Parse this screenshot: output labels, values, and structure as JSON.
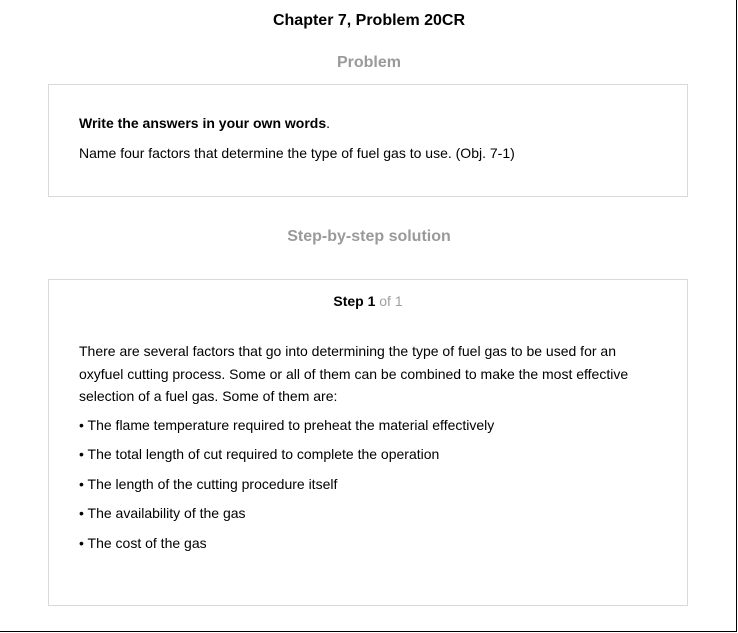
{
  "header": {
    "title": "Chapter 7, Problem 20CR"
  },
  "problem": {
    "heading": "Problem",
    "instruction_bold": "Write the answers in your own words",
    "instruction_end": ".",
    "question": "Name four factors that determine the type of fuel gas to use. (Obj. 7-1)"
  },
  "solution": {
    "heading": "Step-by-step solution",
    "step_word": "Step 1",
    "step_of": " of 1",
    "intro": "There are several factors that go into determining the type of fuel gas to be used for an oxyfuel cutting process. Some or all of them can be combined to make the most effective selection of a fuel gas. Some of them are:",
    "bullets": [
      "• The flame temperature required to preheat the material effectively",
      "• The total length of cut required to complete the operation",
      "• The length of the cutting procedure itself",
      "• The availability of the gas",
      "• The cost of the gas"
    ]
  }
}
